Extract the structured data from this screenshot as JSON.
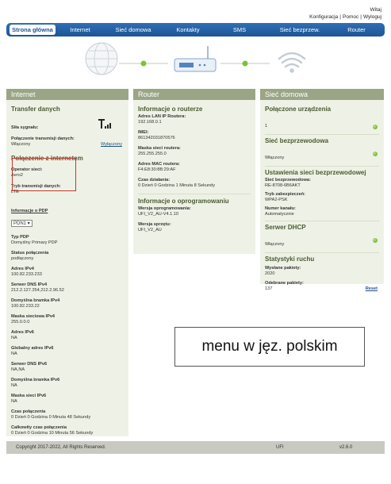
{
  "header": {
    "greeting": "Witaj",
    "links": [
      "Konfiguracja",
      "Pomoc",
      "Wyloguj"
    ]
  },
  "nav": {
    "items": [
      "Strona główna",
      "Internet",
      "Sieć domowa",
      "Kontakty",
      "SMS",
      "Sieć bezprzew.",
      "Router"
    ]
  },
  "internet": {
    "title": "Internet",
    "transfer_title": "Transfer danych",
    "signal_label": "Siła sygnału:",
    "conn_label": "Połączenie transmisji danych:",
    "conn_value": "Włączony",
    "conn_action": "Wyłączony",
    "conn_section": "Połączenie z internetem",
    "operator_label": "Operator sieci:",
    "operator_value": "Aero2",
    "mode_label": "Tryb transmisji danych:",
    "mode_value": "LTE",
    "pdp_info_label": "Informacje o PDP",
    "pdp_selected": "PDN1",
    "fields": [
      {
        "label": "Typ PDP",
        "value": "Domyślny Primary PDP"
      },
      {
        "label": "Status połączenia",
        "value": "podłączony"
      },
      {
        "label": "Adres IPv4",
        "value": "100.82.233.233"
      },
      {
        "label": "Serwer DNS IPv4",
        "value": "212.2.127.254,212.2.96.52"
      },
      {
        "label": "Domyślna bramka IPv4",
        "value": "100.82.233.22"
      },
      {
        "label": "Maska sieciowa IPv4",
        "value": "255.0.0.0"
      },
      {
        "label": "Adres IPv6",
        "value": "NA"
      },
      {
        "label": "Globalny adres IPv6",
        "value": "NA"
      },
      {
        "label": "Serwer DNS IPv6",
        "value": "NA,NA"
      },
      {
        "label": "Domyślna bramka IPv6",
        "value": "NA"
      },
      {
        "label": "Maska sieci IPv6",
        "value": "NA"
      },
      {
        "label": "Czas połączenia",
        "value": "0 Dzień 0 Godzina 0 Minuta 48 Sekundy"
      },
      {
        "label": "Całkowity czas połączenia",
        "value": "0 Dzień 0 Godzina 10 Minuta 56 Sekundy"
      }
    ]
  },
  "router": {
    "title": "Router",
    "info_title": "Informacje o routerze",
    "fields": [
      {
        "label": "Adres LAN IP Routera:",
        "value": "192.168.0.1"
      },
      {
        "label": "IMEI:",
        "value": "861342031870576"
      },
      {
        "label": "Maska sieci routera:",
        "value": "255.255.255.0"
      },
      {
        "label": "Adres MAC routera:",
        "value": "F4:E8:30:8B:29:AF"
      },
      {
        "label": "Czas działania:",
        "value": "0 Dzień 0 Godzina 1 Minuta 8 Sekundy"
      }
    ],
    "sw_title": "Informacje o oprogramowaniu",
    "sw_fields": [
      {
        "label": "Wersja oprogramowania:",
        "value": "UFI_V2_AU-V4.1.10"
      },
      {
        "label": "Wersja sprzętu:",
        "value": "UFI_V2_AU"
      }
    ]
  },
  "home": {
    "title": "Sieć domowa",
    "connected_title": "Połączone urządzenia",
    "connected_value": "1",
    "wifi_title": "Sieć bezprzewodowa",
    "wifi_value": "Włączony",
    "wifi_settings_title": "Ustawienia sieci bezprzewodowej",
    "wifi_fields": [
      {
        "label": "Sieć bezprzewodowa:",
        "value": "RE-8708-6B6AKT"
      },
      {
        "label": "Tryb zabezpieczeń:",
        "value": "WPA2-PSK"
      },
      {
        "label": "Numer kanału:",
        "value": "Automatycznie"
      }
    ],
    "dhcp_title": "Serwer DHCP",
    "dhcp_value": "Włączony",
    "stats_title": "Statystyki ruchu",
    "sent_label": "Wysłane pakiety:",
    "sent_value": "2020",
    "recv_label": "Odebrane pakiety:",
    "recv_value": "137",
    "reset_label": "Reset"
  },
  "footer": {
    "copyright": "Copyright 2017-2022, All Rights Reserved.",
    "model": "UFI",
    "version": "v2.6.0"
  },
  "annotation": "menu w jęz. polskim",
  "colors": {
    "nav": "#1e5496",
    "col_head": "#9aa586",
    "col_bg": "#eef2e6",
    "status_ok": "#5aa020",
    "highlight": "#c0392b"
  }
}
